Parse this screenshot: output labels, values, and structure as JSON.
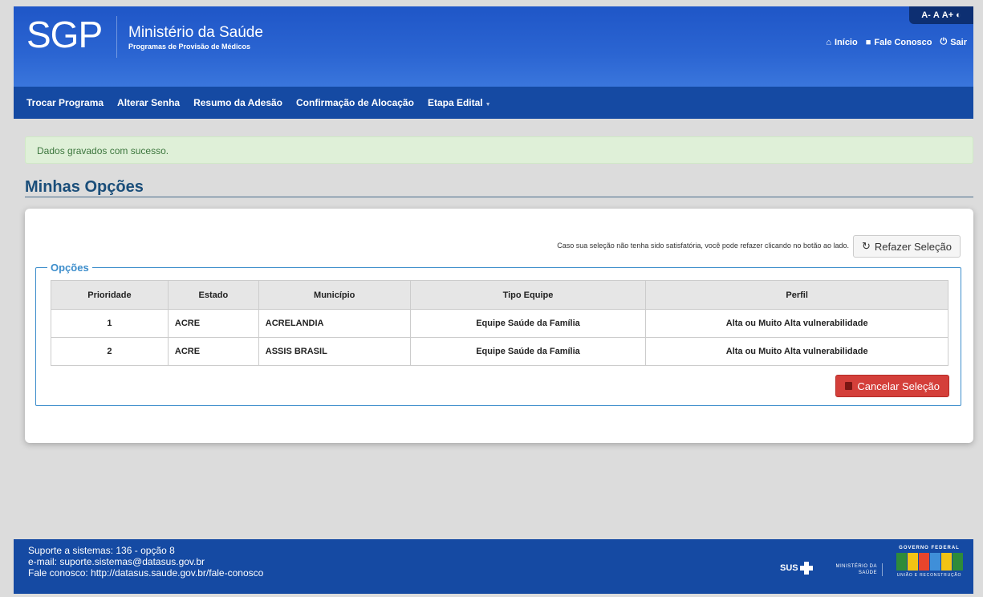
{
  "header": {
    "logo": "SGP",
    "title": "Ministério da Saúde",
    "subtitle": "Programas de Provisão de Médicos",
    "font_tools": [
      "A-",
      "A",
      "A+",
      "◐"
    ],
    "links": {
      "inicio": "Início",
      "contato": "Fale Conosco",
      "sair": "Sair"
    }
  },
  "nav": {
    "items": [
      "Trocar Programa",
      "Alterar Senha",
      "Resumo da Adesão",
      "Confirmação de Alocação",
      "Etapa Edital"
    ]
  },
  "alert": {
    "message": "Dados gravados com sucesso."
  },
  "page": {
    "title": "Minhas Opções"
  },
  "card": {
    "hint": "Caso sua seleção não tenha sido satisfatória, você pode refazer clicando no botão ao lado.",
    "redo_button": "Refazer Seleção",
    "fieldset_legend": "Opções",
    "cancel_button": "Cancelar Seleção"
  },
  "table": {
    "columns": [
      "Prioridade",
      "Estado",
      "Município",
      "Tipo Equipe",
      "Perfil"
    ],
    "rows": [
      [
        "1",
        "ACRE",
        "ACRELANDIA",
        "Equipe Saúde da Família",
        "Alta ou Muito Alta vulnerabilidade"
      ],
      [
        "2",
        "ACRE",
        "ASSIS BRASIL",
        "Equipe Saúde da Família",
        "Alta ou Muito Alta vulnerabilidade"
      ]
    ]
  },
  "footer": {
    "line1": "Suporte a sistemas: 136 - opção 8",
    "line2": "e-mail: suporte.sistemas@datasus.gov.br",
    "line3": "Fale conosco: http://datasus.saude.gov.br/fale-conosco",
    "sus": "SUS",
    "ministerio_line1": "MINISTÉRIO DA",
    "ministerio_line2": "SAÚDE",
    "gov_federal": "GOVERNO FEDERAL",
    "brasil_tagline": "UNIÃO E RECONSTRUÇÃO"
  },
  "colors": {
    "header": "#2b65d2",
    "nav": "#154aa3",
    "alert_bg": "#dff0d8",
    "title": "#1a4e7a",
    "legend": "#3c8dcb",
    "danger": "#d43f3a"
  }
}
